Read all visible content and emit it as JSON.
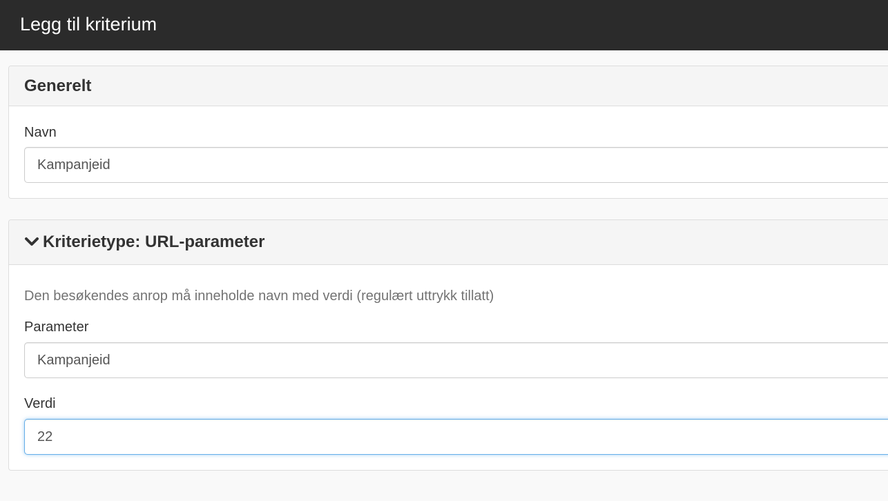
{
  "header": {
    "title": "Legg til kriterium"
  },
  "general_panel": {
    "title": "Generelt",
    "name_field": {
      "label": "Navn",
      "value": "Kampanjeid"
    }
  },
  "criteria_panel": {
    "title": "Kriterietype: URL-parameter",
    "toggle_icon": "chevron-down-icon",
    "help_text": "Den besøkendes anrop må inneholde navn med verdi (regulært uttrykk tillatt)",
    "parameter_field": {
      "label": "Parameter",
      "value": "Kampanjeid"
    },
    "value_field": {
      "label": "Verdi",
      "value": "22",
      "focused": true
    }
  },
  "colors": {
    "header_bg": "#2b2b2b",
    "focus_border": "#66afe9"
  }
}
